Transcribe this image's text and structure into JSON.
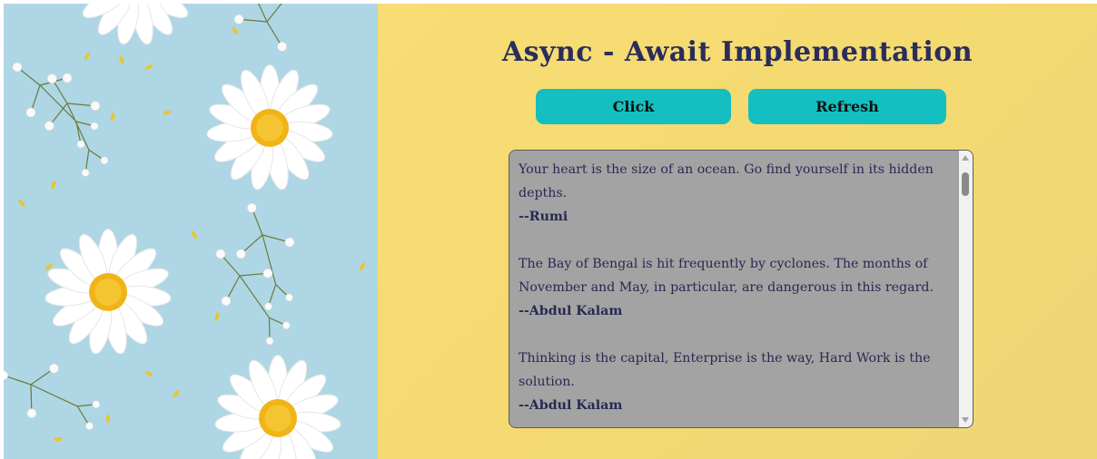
{
  "header": {
    "title": "Async - Await Implementation"
  },
  "buttons": {
    "click_label": "Click",
    "refresh_label": "Refresh"
  },
  "quotes": [
    {
      "text": "Your heart is the size of an ocean. Go find yourself in its hidden depths.",
      "author": "--Rumi"
    },
    {
      "text": "The Bay of Bengal is hit frequently by cyclones. The months of November and May, in particular, are dangerous in this regard.",
      "author": "--Abdul Kalam"
    },
    {
      "text": "Thinking is the capital, Enterprise is the way, Hard Work is the solution.",
      "author": "--Abdul Kalam"
    }
  ],
  "colors": {
    "left_background": "#aed6e4",
    "right_background": "#f4da70",
    "title": "#2a2d5a",
    "button": "#13bfc1",
    "quote_box": "#a4a3a3",
    "quote_text": "#262a52"
  },
  "decoration": {
    "left_panel_image": "daisy-flowers-on-light-blue"
  }
}
